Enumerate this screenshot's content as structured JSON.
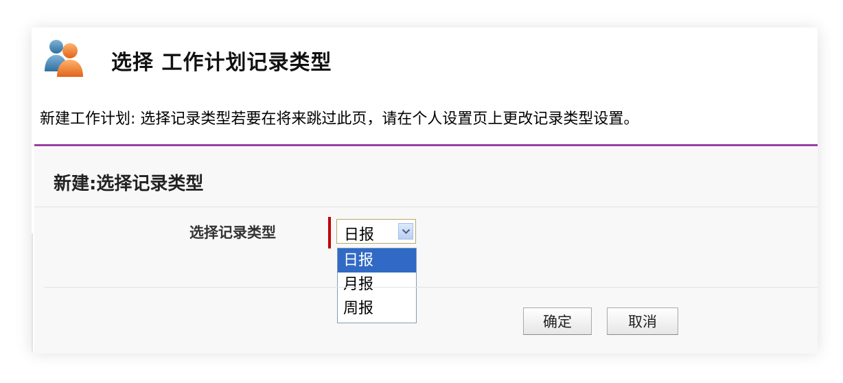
{
  "header": {
    "title": "选择 工作计划记录类型",
    "icon": "users-icon"
  },
  "intro": {
    "text": "新建工作计划: 选择记录类型若要在将来跳过此页，请在个人设置页上更改记录类型设置。"
  },
  "section": {
    "title": "新建:选择记录类型",
    "accent_color": "#9a3ea6"
  },
  "record_type": {
    "label": "选择记录类型",
    "selected": "日报",
    "options": [
      "日报",
      "月报",
      "周报"
    ],
    "required_color": "#c00000"
  },
  "actions": {
    "ok_label": "确定",
    "cancel_label": "取消"
  }
}
